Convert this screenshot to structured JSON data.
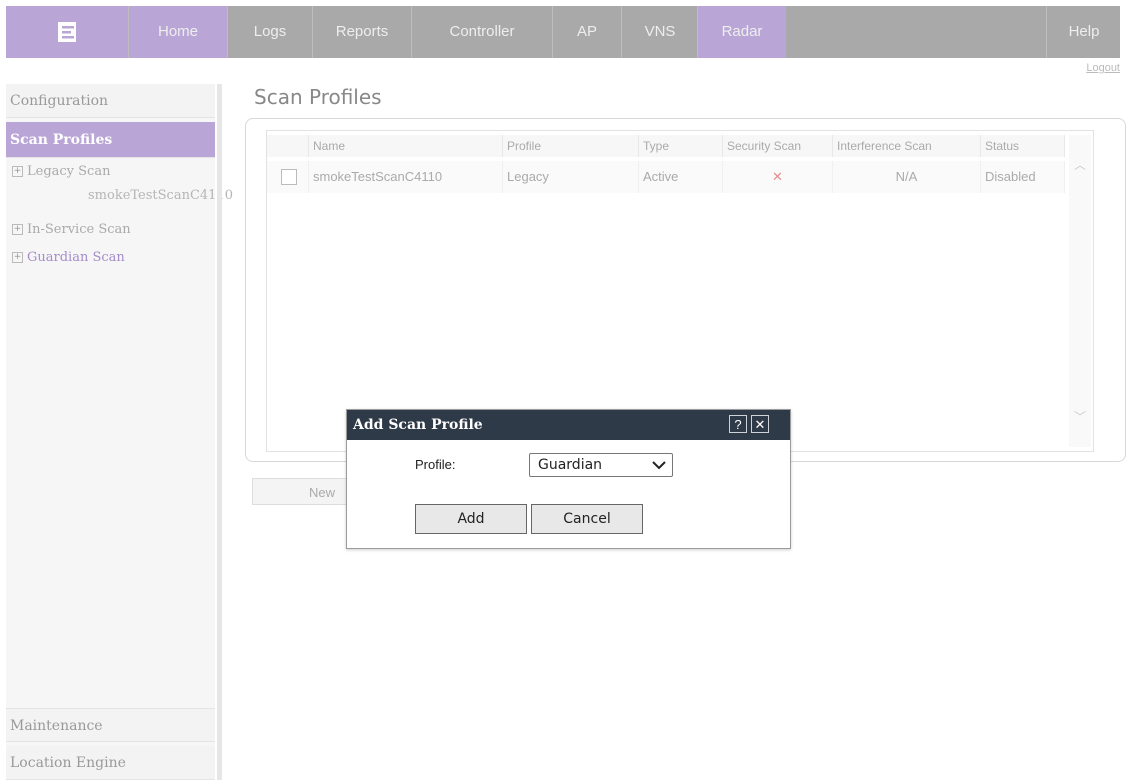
{
  "topnav": {
    "items": [
      {
        "label": "Home"
      },
      {
        "label": "Logs"
      },
      {
        "label": "Reports"
      },
      {
        "label": "Controller"
      },
      {
        "label": "AP"
      },
      {
        "label": "VNS"
      },
      {
        "label": "Radar"
      },
      {
        "label": "Help"
      }
    ],
    "logout": "Logout"
  },
  "sidebar": {
    "configuration": "Configuration",
    "scan_profiles": "Scan Profiles",
    "tree": [
      {
        "label": "Legacy Scan",
        "toggle": "+"
      },
      {
        "label": "smokeTestScanC4110"
      },
      {
        "label": "In-Service Scan",
        "toggle": "+"
      },
      {
        "label": "Guardian Scan",
        "toggle": "+"
      }
    ],
    "maintenance": "Maintenance",
    "location_engine": "Location Engine"
  },
  "main": {
    "title": "Scan Profiles",
    "columns": [
      "Name",
      "Profile",
      "Type",
      "Security Scan",
      "Interference Scan",
      "Status"
    ],
    "rows": [
      {
        "name": "smokeTestScanC4110",
        "profile": "Legacy",
        "type": "Active",
        "security": "✕",
        "interference": "N/A",
        "status": "Disabled"
      }
    ],
    "new_button": "New"
  },
  "dialog": {
    "title": "Add Scan Profile",
    "help": "?",
    "close": "✕",
    "profile_label": "Profile:",
    "profile_value": "Guardian",
    "add_label": "Add",
    "cancel_label": "Cancel"
  },
  "colors": {
    "accent": "#b9a6d6",
    "nav_bg": "#a9a9a9",
    "dialog_title": "#2f3a48"
  }
}
